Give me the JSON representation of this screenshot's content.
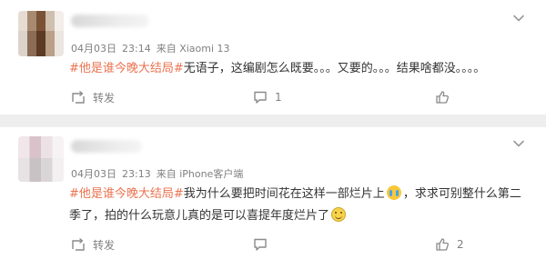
{
  "comments": [
    {
      "meta": {
        "date": "04月03日",
        "time": "23:14",
        "source": "来自 Xiaomi 13"
      },
      "topic": "#他是谁今晚大结局#",
      "text": "无语子，这编剧怎么既要。。。又要的。。。结果啥都没。。。。",
      "actions": {
        "forward_label": "转发",
        "comment_count": "1",
        "like_count": ""
      }
    },
    {
      "meta": {
        "date": "04月03日",
        "time": "23:13",
        "source": "来自 iPhone客户端"
      },
      "topic": "#他是谁今晚大结局#",
      "text_part1": "我为什么要把时间花在这样一部烂片上",
      "text_part2": "，求求可别整什么第二季了，拍的什么玩意儿真的是可以喜提年度烂片了",
      "actions": {
        "forward_label": "转发",
        "comment_count": "",
        "like_count": "2"
      }
    }
  ],
  "icons": [
    "chevron-down-icon",
    "forward-icon",
    "comment-icon",
    "like-icon",
    "crying-emoji-icon",
    "smile-emoji-icon"
  ],
  "colors": {
    "topic": "#eb7350",
    "meta": "#808080",
    "text": "#333333",
    "background": "#eeeeee"
  }
}
